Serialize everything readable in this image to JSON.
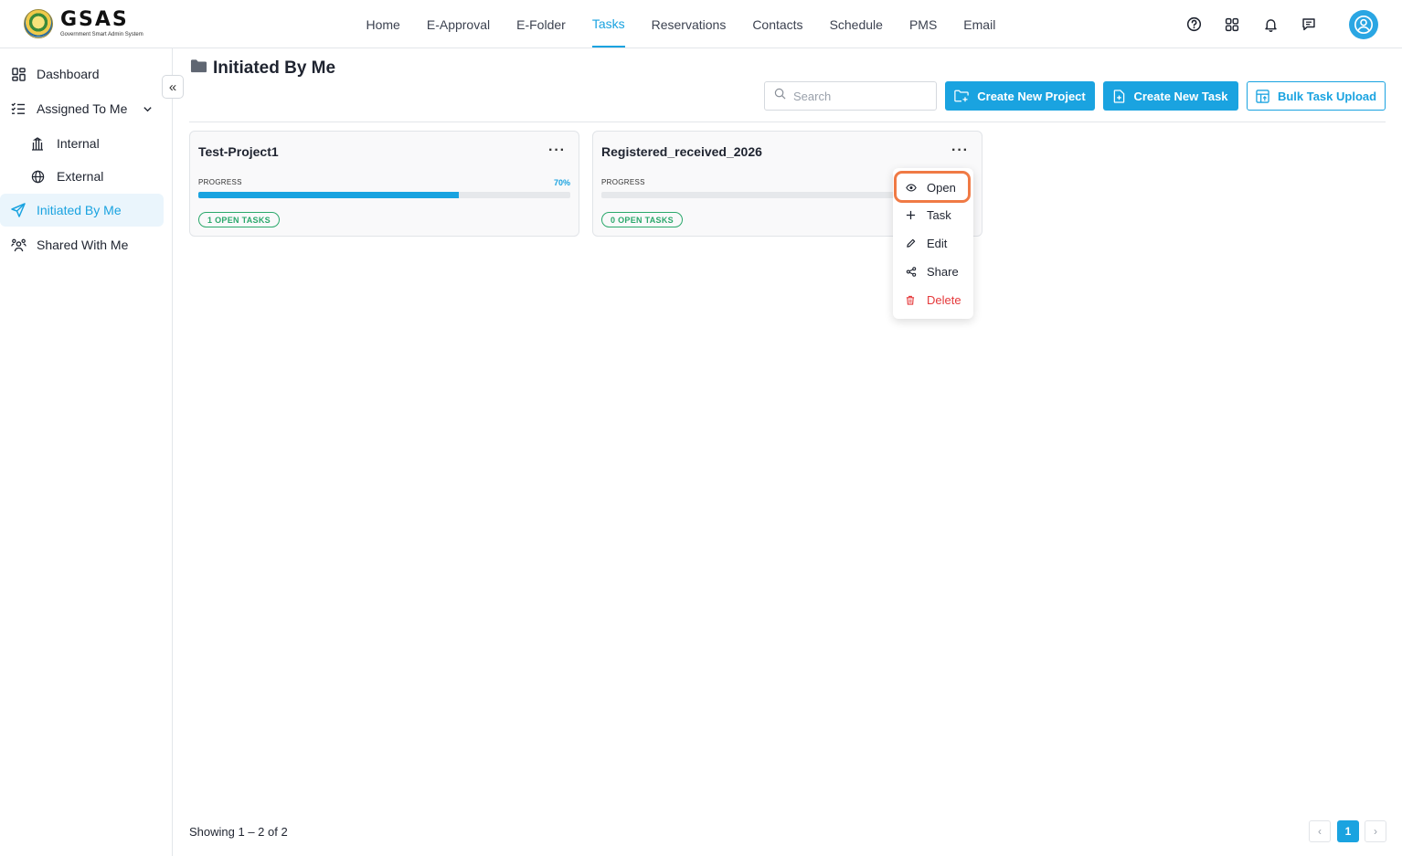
{
  "app": {
    "logo_text": "GSAS",
    "logo_subtitle": "Government Smart Admin System"
  },
  "nav": {
    "items": [
      "Home",
      "E-Approval",
      "E-Folder",
      "Tasks",
      "Reservations",
      "Contacts",
      "Schedule",
      "PMS",
      "Email"
    ],
    "active": "Tasks"
  },
  "sidebar": {
    "dashboard": "Dashboard",
    "assigned_to_me": "Assigned To Me",
    "internal": "Internal",
    "external": "External",
    "initiated_by_me": "Initiated By Me",
    "shared_with_me": "Shared With Me",
    "collapse_icon": "«"
  },
  "main": {
    "title": "Initiated By Me",
    "search_placeholder": "Search",
    "create_project": "Create New Project",
    "create_task": "Create New Task",
    "bulk_upload": "Bulk Task Upload"
  },
  "projects": [
    {
      "name": "Test-Project1",
      "progress_label": "PROGRESS",
      "progress": 70,
      "progress_text": "70%",
      "open_tasks": "1 OPEN TASKS",
      "menu": "···"
    },
    {
      "name": "Registered_received_2026",
      "progress_label": "PROGRESS",
      "progress": 0,
      "progress_text": "",
      "open_tasks": "0 OPEN TASKS",
      "menu": "···"
    }
  ],
  "context_menu": {
    "open": "Open",
    "task": "Task",
    "edit": "Edit",
    "share": "Share",
    "delete": "Delete"
  },
  "footer": {
    "showing": "Showing 1 – 2 of 2",
    "prev": "‹",
    "current_page": "1",
    "next": "›"
  },
  "colors": {
    "accent": "#1aa3e0",
    "success": "#2aa86b",
    "danger": "#e5393b",
    "highlight": "#f07a45"
  }
}
